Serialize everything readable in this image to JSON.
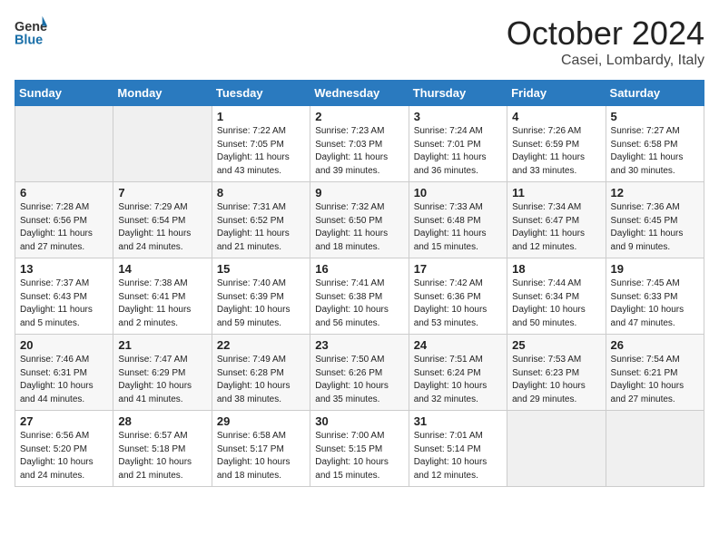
{
  "header": {
    "logo_general": "General",
    "logo_blue": "Blue",
    "month": "October 2024",
    "location": "Casei, Lombardy, Italy"
  },
  "weekdays": [
    "Sunday",
    "Monday",
    "Tuesday",
    "Wednesday",
    "Thursday",
    "Friday",
    "Saturday"
  ],
  "weeks": [
    [
      {
        "day": "",
        "info": ""
      },
      {
        "day": "",
        "info": ""
      },
      {
        "day": "1",
        "info": "Sunrise: 7:22 AM\nSunset: 7:05 PM\nDaylight: 11 hours and 43 minutes."
      },
      {
        "day": "2",
        "info": "Sunrise: 7:23 AM\nSunset: 7:03 PM\nDaylight: 11 hours and 39 minutes."
      },
      {
        "day": "3",
        "info": "Sunrise: 7:24 AM\nSunset: 7:01 PM\nDaylight: 11 hours and 36 minutes."
      },
      {
        "day": "4",
        "info": "Sunrise: 7:26 AM\nSunset: 6:59 PM\nDaylight: 11 hours and 33 minutes."
      },
      {
        "day": "5",
        "info": "Sunrise: 7:27 AM\nSunset: 6:58 PM\nDaylight: 11 hours and 30 minutes."
      }
    ],
    [
      {
        "day": "6",
        "info": "Sunrise: 7:28 AM\nSunset: 6:56 PM\nDaylight: 11 hours and 27 minutes."
      },
      {
        "day": "7",
        "info": "Sunrise: 7:29 AM\nSunset: 6:54 PM\nDaylight: 11 hours and 24 minutes."
      },
      {
        "day": "8",
        "info": "Sunrise: 7:31 AM\nSunset: 6:52 PM\nDaylight: 11 hours and 21 minutes."
      },
      {
        "day": "9",
        "info": "Sunrise: 7:32 AM\nSunset: 6:50 PM\nDaylight: 11 hours and 18 minutes."
      },
      {
        "day": "10",
        "info": "Sunrise: 7:33 AM\nSunset: 6:48 PM\nDaylight: 11 hours and 15 minutes."
      },
      {
        "day": "11",
        "info": "Sunrise: 7:34 AM\nSunset: 6:47 PM\nDaylight: 11 hours and 12 minutes."
      },
      {
        "day": "12",
        "info": "Sunrise: 7:36 AM\nSunset: 6:45 PM\nDaylight: 11 hours and 9 minutes."
      }
    ],
    [
      {
        "day": "13",
        "info": "Sunrise: 7:37 AM\nSunset: 6:43 PM\nDaylight: 11 hours and 5 minutes."
      },
      {
        "day": "14",
        "info": "Sunrise: 7:38 AM\nSunset: 6:41 PM\nDaylight: 11 hours and 2 minutes."
      },
      {
        "day": "15",
        "info": "Sunrise: 7:40 AM\nSunset: 6:39 PM\nDaylight: 10 hours and 59 minutes."
      },
      {
        "day": "16",
        "info": "Sunrise: 7:41 AM\nSunset: 6:38 PM\nDaylight: 10 hours and 56 minutes."
      },
      {
        "day": "17",
        "info": "Sunrise: 7:42 AM\nSunset: 6:36 PM\nDaylight: 10 hours and 53 minutes."
      },
      {
        "day": "18",
        "info": "Sunrise: 7:44 AM\nSunset: 6:34 PM\nDaylight: 10 hours and 50 minutes."
      },
      {
        "day": "19",
        "info": "Sunrise: 7:45 AM\nSunset: 6:33 PM\nDaylight: 10 hours and 47 minutes."
      }
    ],
    [
      {
        "day": "20",
        "info": "Sunrise: 7:46 AM\nSunset: 6:31 PM\nDaylight: 10 hours and 44 minutes."
      },
      {
        "day": "21",
        "info": "Sunrise: 7:47 AM\nSunset: 6:29 PM\nDaylight: 10 hours and 41 minutes."
      },
      {
        "day": "22",
        "info": "Sunrise: 7:49 AM\nSunset: 6:28 PM\nDaylight: 10 hours and 38 minutes."
      },
      {
        "day": "23",
        "info": "Sunrise: 7:50 AM\nSunset: 6:26 PM\nDaylight: 10 hours and 35 minutes."
      },
      {
        "day": "24",
        "info": "Sunrise: 7:51 AM\nSunset: 6:24 PM\nDaylight: 10 hours and 32 minutes."
      },
      {
        "day": "25",
        "info": "Sunrise: 7:53 AM\nSunset: 6:23 PM\nDaylight: 10 hours and 29 minutes."
      },
      {
        "day": "26",
        "info": "Sunrise: 7:54 AM\nSunset: 6:21 PM\nDaylight: 10 hours and 27 minutes."
      }
    ],
    [
      {
        "day": "27",
        "info": "Sunrise: 6:56 AM\nSunset: 5:20 PM\nDaylight: 10 hours and 24 minutes."
      },
      {
        "day": "28",
        "info": "Sunrise: 6:57 AM\nSunset: 5:18 PM\nDaylight: 10 hours and 21 minutes."
      },
      {
        "day": "29",
        "info": "Sunrise: 6:58 AM\nSunset: 5:17 PM\nDaylight: 10 hours and 18 minutes."
      },
      {
        "day": "30",
        "info": "Sunrise: 7:00 AM\nSunset: 5:15 PM\nDaylight: 10 hours and 15 minutes."
      },
      {
        "day": "31",
        "info": "Sunrise: 7:01 AM\nSunset: 5:14 PM\nDaylight: 10 hours and 12 minutes."
      },
      {
        "day": "",
        "info": ""
      },
      {
        "day": "",
        "info": ""
      }
    ]
  ]
}
